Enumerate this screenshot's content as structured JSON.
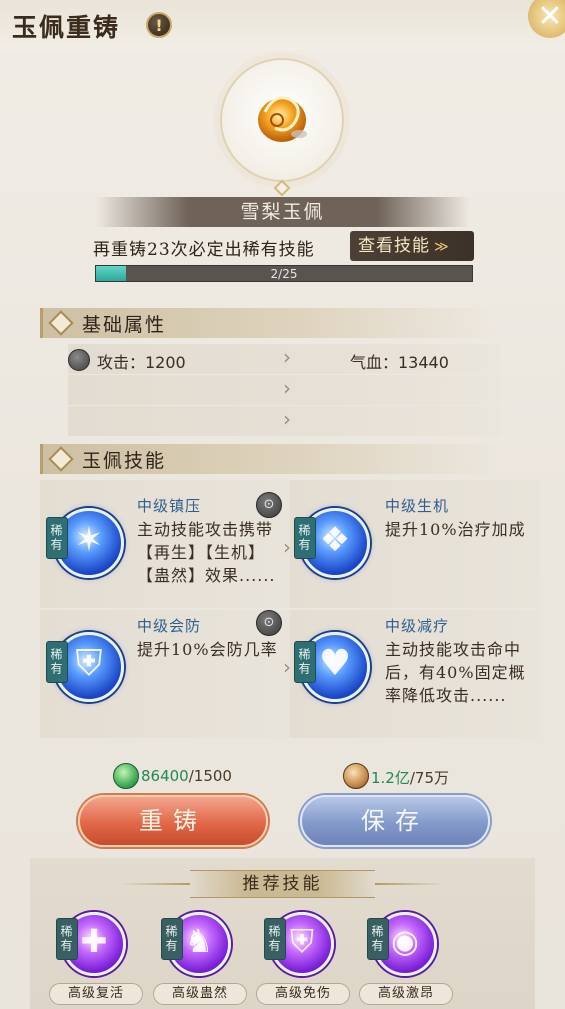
{
  "header": {
    "title": "玉佩重铸",
    "info_symbol": "!",
    "close_symbol": "✕"
  },
  "jade": {
    "name": "雪梨玉佩"
  },
  "reforge": {
    "tip": "再重铸23次必定出稀有技能",
    "view_skills_label": "查看技能",
    "view_skills_arrow": "≫",
    "progress_text": "2/25",
    "progress_fraction": 0.08
  },
  "base_attrs": {
    "title": "基础属性",
    "rows": [
      {
        "left": "攻击：1200",
        "arrow": "›",
        "right": "气血：13440"
      },
      {
        "left": "",
        "arrow": "›",
        "right": ""
      },
      {
        "left": "",
        "arrow": "›",
        "right": ""
      }
    ]
  },
  "skills": {
    "title": "玉佩技能",
    "items": [
      {
        "tag": "稀有",
        "name": "中级镇压",
        "desc": "主动技能攻击携带【再生】【生机】【蛊然】效果......"
      },
      {
        "tag": "稀有",
        "name": "中级生机",
        "desc": "提升10%治疗加成"
      },
      {
        "tag": "稀有",
        "name": "中级会防",
        "desc": "提升10%会防几率"
      },
      {
        "tag": "稀有",
        "name": "中级减疗",
        "desc": "主动技能攻击命中后，有40%固定概率降低攻击......"
      }
    ]
  },
  "costs": [
    {
      "icon": "jade-coin-icon",
      "have": "86400",
      "need": "/1500"
    },
    {
      "icon": "gold-coin-icon",
      "have": "1.2亿",
      "need": "/75万"
    }
  ],
  "buttons": {
    "reforge": "重铸",
    "save": "保存"
  },
  "recommended": {
    "title": "推荐技能",
    "items": [
      {
        "tag": "稀有",
        "label": "高级复活"
      },
      {
        "tag": "稀有",
        "label": "高级蛊然"
      },
      {
        "tag": "稀有",
        "label": "高级免伤"
      },
      {
        "tag": "稀有",
        "label": "高级激昂"
      }
    ]
  },
  "colors": {
    "accent_gold": "#c9a968",
    "rare_tag": "#2f6f73",
    "skill_name": "#2f5f8e",
    "cost_have": "#1f8a50"
  }
}
